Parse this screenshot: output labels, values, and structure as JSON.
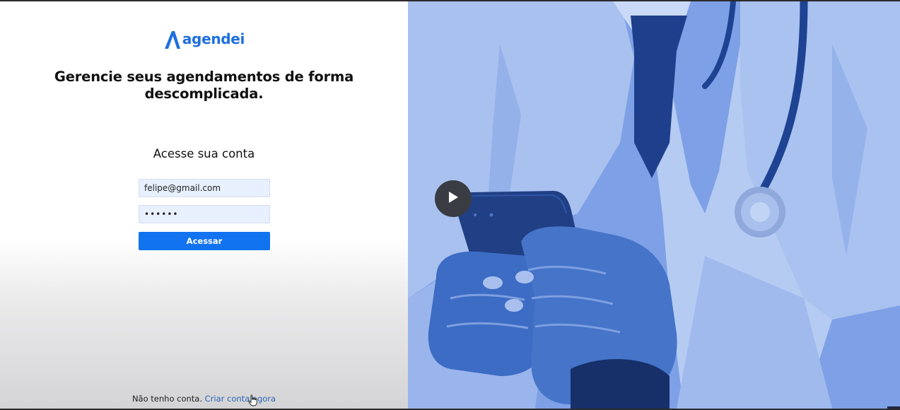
{
  "brand": {
    "name": "agendei",
    "color": "#1f6fe0"
  },
  "login": {
    "headline": "Gerencie seus agendamentos de forma descomplicada.",
    "subtitle": "Acesse sua conta",
    "email_value": "felipe@gmail.com",
    "password_value": "123456",
    "submit_label": "Acessar",
    "accent": "#1273f0"
  },
  "footer": {
    "text": "Não tenho conta.",
    "link": "Criar conta agora"
  },
  "media": {
    "play_icon": "play-icon",
    "overlay_color": "#7ea0e6"
  }
}
